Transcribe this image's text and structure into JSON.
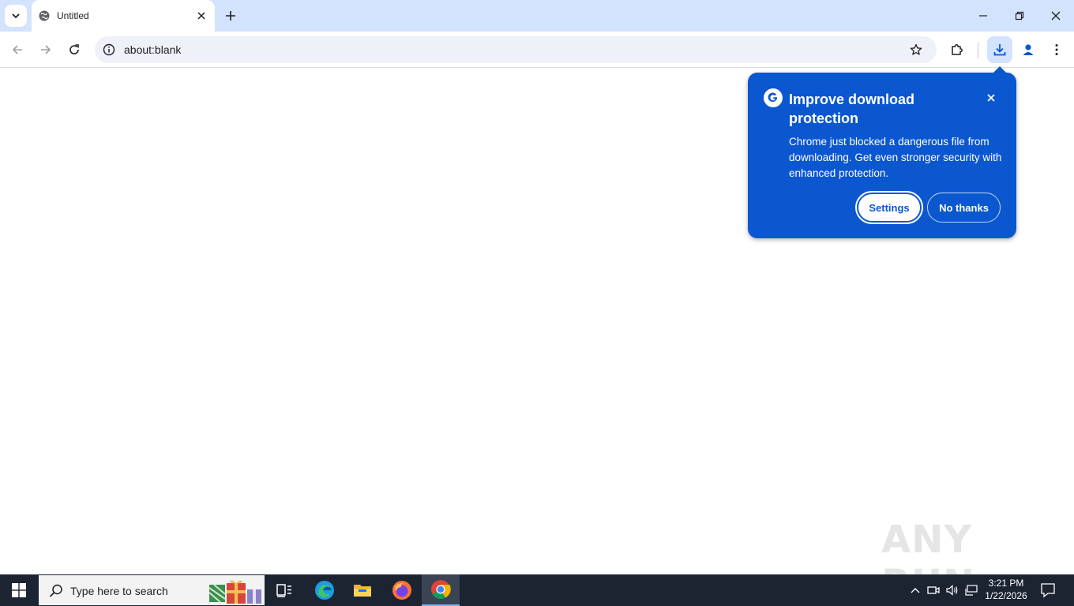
{
  "browser": {
    "tab": {
      "title": "Untitled"
    },
    "omnibox": {
      "url": "about:blank"
    }
  },
  "download_bubble": {
    "title": "Improve download protection",
    "body": "Chrome just blocked a dangerous file from downloading. Get even stronger security with enhanced protection.",
    "settings_label": "Settings",
    "no_thanks_label": "No thanks"
  },
  "watermark": {
    "text": "ANY RUN"
  },
  "taskbar": {
    "search_placeholder": "Type here to search",
    "clock": {
      "time": "3:21 PM",
      "date": "1/22/2026"
    }
  },
  "colors": {
    "accent": "#0b57d0",
    "tabstrip": "#d3e3fd",
    "taskbar": "#1c2432"
  }
}
